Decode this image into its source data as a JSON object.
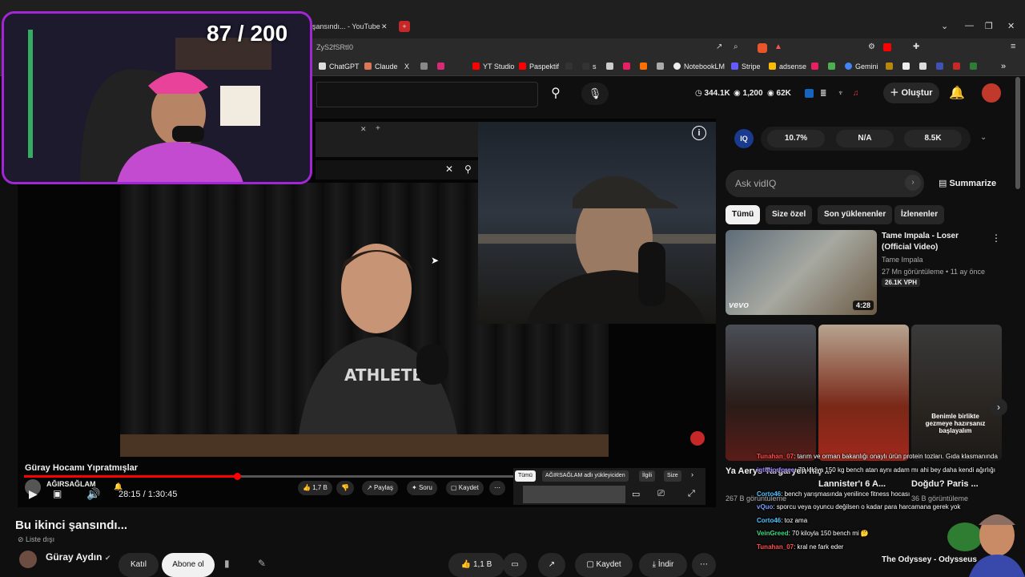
{
  "browser": {
    "tab_title": "şansındı... - YouTube",
    "url_fragment": "ZyS2fSRtI0",
    "bookmarks": [
      "ChatGPT",
      "Claude",
      "X",
      "",
      "",
      "YT Studio",
      "Paspektif",
      "",
      "s",
      "",
      "",
      "",
      "",
      "",
      "NotebookLM",
      "Stripe",
      "adsense",
      "",
      "",
      "Gemini"
    ]
  },
  "header": {
    "stats": [
      "344.1K",
      "1,200",
      "62K"
    ],
    "create_label": "Oluştur"
  },
  "overlay": {
    "counter": "87 / 200"
  },
  "player": {
    "title": "Güray Hocamı Yıpratmışlar",
    "channel": "AĞIRSAĞLAM",
    "time": "28:15 / 1:30:45",
    "progress_fraction": 0.315,
    "actions": {
      "likes": "1,7 B",
      "share": "Paylaş",
      "ask": "Soru",
      "save": "Kaydet"
    },
    "inner_chips": [
      "Tümü",
      "AĞIRSAĞLAM adlı yükleyiciden",
      "İlgili",
      "Size"
    ]
  },
  "video": {
    "title": "Bu ikinci şansındı...",
    "visibility": "Liste dışı",
    "channel": "Güray Aydın",
    "join_label": "Katıl",
    "subscribe_label": "Abone ol",
    "like_count": "1,1 B",
    "save_label": "Kaydet",
    "download_label": "İndir"
  },
  "sidebar": {
    "iq_label": "IQ",
    "iq_stats": [
      "10.7%",
      "N/A",
      "8.5K"
    ],
    "ask_placeholder": "Ask vidIQ",
    "summarize_label": "Summarize",
    "chips": [
      "Tümü",
      "Size özel",
      "Son yüklenenler",
      "İzlenenler"
    ],
    "rec1": {
      "title": "Tame Impala - Loser (Official Video)",
      "channel": "Tame Impala",
      "meta": "27 Mn görüntüleme • 11 ay önce",
      "vph": "26.1K VPH",
      "duration": "4:28",
      "logo": "vevo"
    },
    "shorts_titles": [
      "Ya Aerys Targaryen hiç ...",
      "Lannister'ı 6 A...",
      "Doğdu? Paris ..."
    ],
    "shorts_views": [
      "267 B görüntüleme",
      "",
      "36 B görüntüleme"
    ],
    "short_caption": "Benimle birlikte gezmeye hazırsanız başlayalım",
    "bottom_title": "The Odyssey - Odysseus"
  },
  "chat": [
    {
      "user": "Tunahan_07",
      "text": ": tarım ve orman bakanlığı onaylı ürün protein tozları. Gıda klasmanında"
    },
    {
      "user": "interiorforce",
      "text": ": 70 kiloya 150 kg bench atan aynı adam mı ahi bey daha kendi ağırlığı"
    },
    {
      "user": "Corto46",
      "text": ": bench yarışmasında yenilince fitness hocası"
    },
    {
      "user": "vQuo",
      "text": ": sporcu veya oyuncu değilsen o kadar para harcamana gerek yok"
    },
    {
      "user": "Corto46",
      "text": ": toz ama"
    },
    {
      "user": "VeinGreed",
      "text": ": 70 kiloyla 150 bench mi 🤔"
    },
    {
      "user": "Tunahan_07",
      "text": ": kral ne fark eder"
    }
  ]
}
